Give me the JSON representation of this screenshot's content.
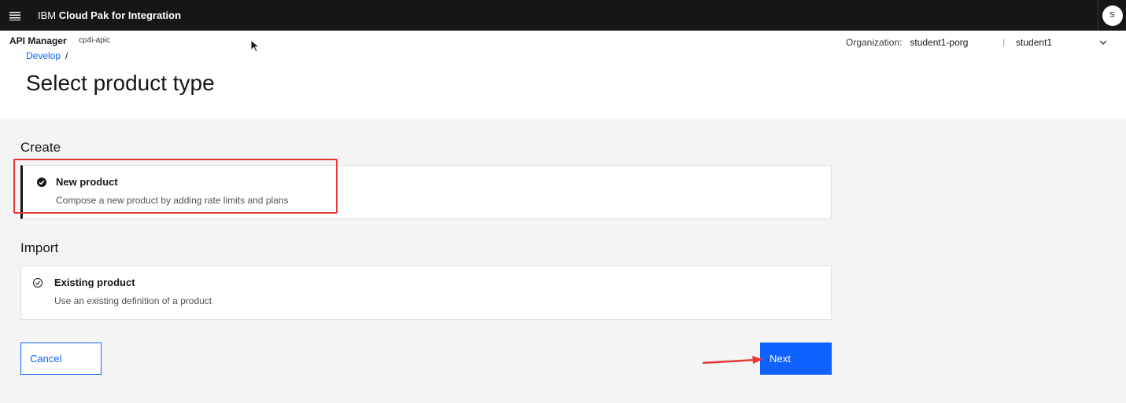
{
  "topbar": {
    "brand_prefix": "IBM",
    "brand_name": "Cloud Pak for Integration",
    "avatar_initial": "S"
  },
  "header": {
    "app_name": "API Manager",
    "app_instance": "cp4i-apic",
    "breadcrumb": {
      "items": [
        "Develop"
      ],
      "separator": "/"
    },
    "page_title": "Select product type",
    "org": {
      "label": "Organization:",
      "value": "student1-porg",
      "divider": "|",
      "user": "student1"
    }
  },
  "create_section": {
    "label": "Create",
    "tile": {
      "title": "New product",
      "description": "Compose a new product by adding rate limits and plans",
      "selected": true
    }
  },
  "import_section": {
    "label": "Import",
    "tile": {
      "title": "Existing product",
      "description": "Use an existing definition of a product",
      "selected": false
    }
  },
  "actions": {
    "cancel_label": "Cancel",
    "next_label": "Next"
  },
  "colors": {
    "accent": "#0f62fe",
    "topbar": "#161616",
    "annotation": "#e53935"
  },
  "icons": {
    "menu": "hamburger-icon",
    "org_dropdown": "chevron-down-icon",
    "selected": "checkmark-filled-icon",
    "unselected": "checkmark-outline-icon"
  }
}
